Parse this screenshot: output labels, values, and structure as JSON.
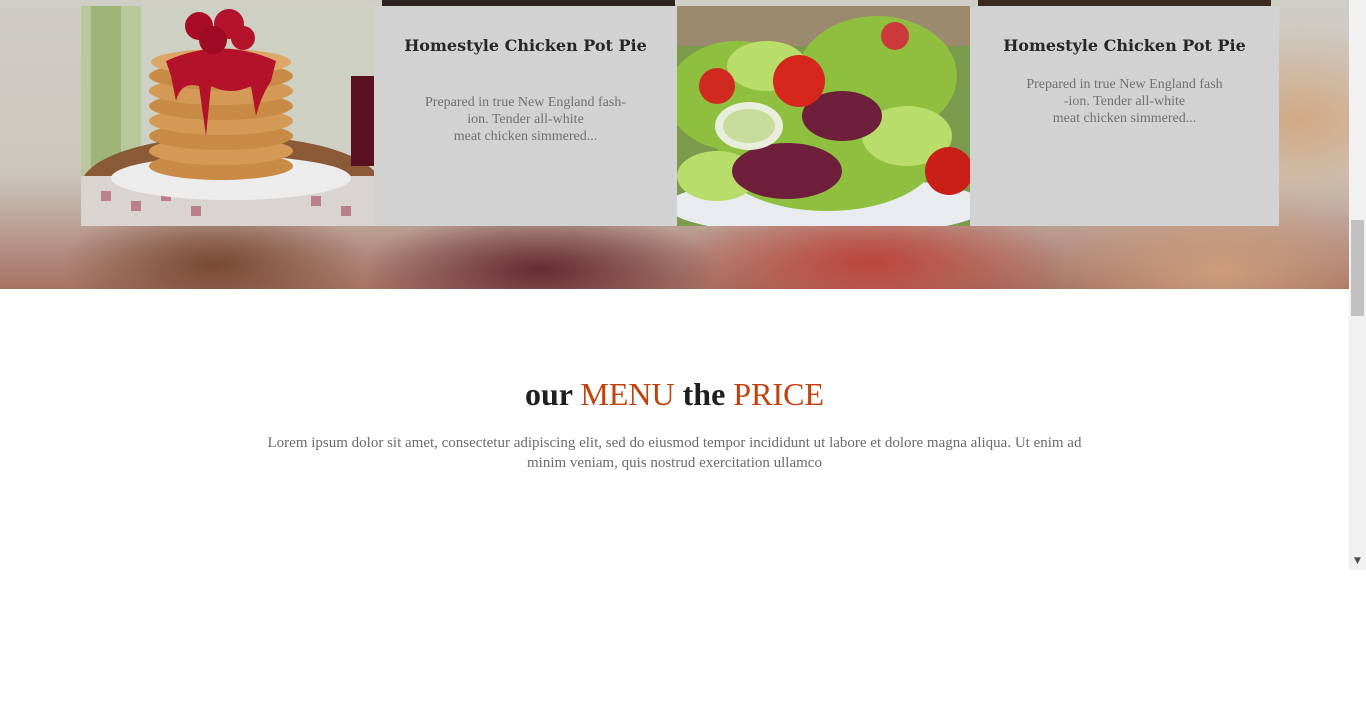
{
  "cards": [
    {
      "image_icon": "pancakes-photo",
      "title": "Homestyle Chicken Pot Pie",
      "description_lines": [
        "Prepared in true New England fash-",
        "ion. Tender all-white",
        "meat chicken simmered..."
      ]
    },
    {
      "image_icon": "salad-photo",
      "title": "Homestyle Chicken Pot Pie",
      "description_lines": [
        "Prepared in true New England fash",
        "-ion. Tender all-white",
        "meat chicken simmered..."
      ]
    }
  ],
  "menu_section": {
    "heading_our": "our",
    "heading_menu": "MENU",
    "heading_the": "the",
    "heading_price": "PRICE",
    "accent_color": "#c2410c",
    "subtitle_lines": [
      "Lorem ipsum dolor sit amet, consectetur adipiscing elit, sed do eiusmod tempor incididunt ut labore et dolore magna aliqua. Ut enim ad",
      "minim veniam, quis nostrud exercitation ullamco"
    ]
  },
  "scrollbar": {
    "arrow_glyph": "▼"
  }
}
